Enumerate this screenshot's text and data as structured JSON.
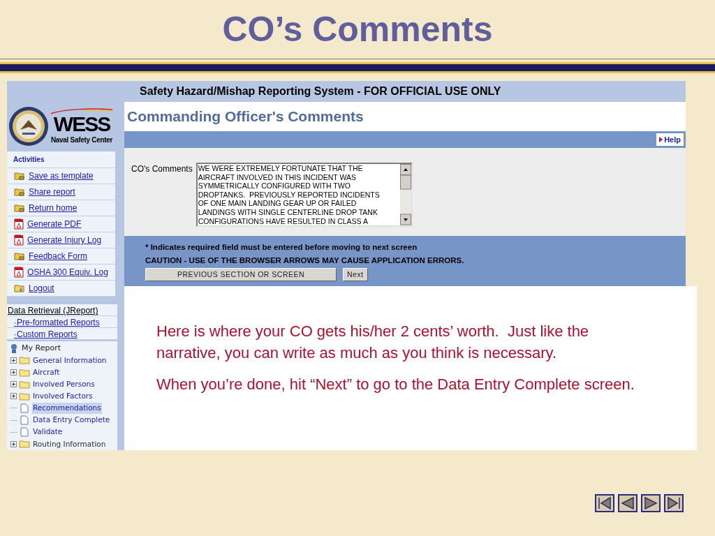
{
  "slide_title": "CO’s Comments",
  "app": {
    "header": "Safety Hazard/Mishap Reporting System - FOR OFFICIAL USE ONLY",
    "logo": {
      "wordmark": "WESS",
      "subtitle": "Naval Safety Center"
    },
    "activities": {
      "title": "Activities",
      "items": [
        {
          "label": "Save as template",
          "kind": "folder"
        },
        {
          "label": "Share report",
          "kind": "folder"
        },
        {
          "label": "Return home",
          "kind": "folder"
        },
        {
          "label": "Generate PDF",
          "kind": "pdf"
        },
        {
          "label": "Generate Injury Log",
          "kind": "pdf"
        },
        {
          "label": "Feedback Form",
          "kind": "folder"
        },
        {
          "label": "OSHA 300 Equiv. Log",
          "kind": "pdf"
        },
        {
          "label": "Logout",
          "kind": "logout"
        }
      ]
    },
    "data_retrieval": {
      "title": "Data Retrieval (JReport)",
      "links": [
        "·Pre-formatted Reports",
        "·Custom Reports"
      ]
    },
    "tree": {
      "label": "My Report",
      "children": [
        {
          "label": "General Information",
          "kind": "folder",
          "expanded": false,
          "selected": false
        },
        {
          "label": "Aircraft",
          "kind": "folder",
          "expanded": false,
          "selected": false
        },
        {
          "label": "Involved Persons",
          "kind": "folder",
          "expanded": false,
          "selected": false
        },
        {
          "label": "Involved Factors",
          "kind": "folder",
          "expanded": false,
          "selected": false
        },
        {
          "label": "Recommendations",
          "kind": "page",
          "selected": true
        },
        {
          "label": "Data Entry Complete",
          "kind": "page",
          "selected": false
        },
        {
          "label": "Validate",
          "kind": "page",
          "selected": false
        },
        {
          "label": "Routing Information",
          "kind": "folder",
          "expanded": false,
          "selected": false
        }
      ]
    },
    "page_title": "Commanding Officer's Comments",
    "help": "Help",
    "form": {
      "label": "CO's Comments",
      "value": "WE WERE EXTREMELY FORTUNATE THAT THE\nAIRCRAFT INVOLVED IN THIS INCIDENT WAS\nSYMMETRICALLY CONFIGURED WITH TWO\nDROPTANKS.  PREVIOUSLY REPORTED INCIDENTS\nOF ONE MAIN LANDING GEAR UP OR FAILED\nLANDINGS WITH SINGLE CENTERLINE DROP TANK\nCONFIGURATIONS HAVE RESULTED IN CLASS A"
    },
    "notes": [
      "* Indicates required field must be entered before moving to next screen",
      "CAUTION - USE OF THE BROWSER ARROWS MAY CAUSE APPLICATION ERRORS."
    ],
    "buttons": [
      "PREVIOUS SECTION OR SCREEN",
      "Next"
    ]
  },
  "slide_text": [
    "Here is where your CO gets his/her 2 cents’ worth.  Just like the narrative, you can write as much as you think is necessary.",
    "When you’re done, hit “Next” to go to the Data Entry Complete screen."
  ]
}
